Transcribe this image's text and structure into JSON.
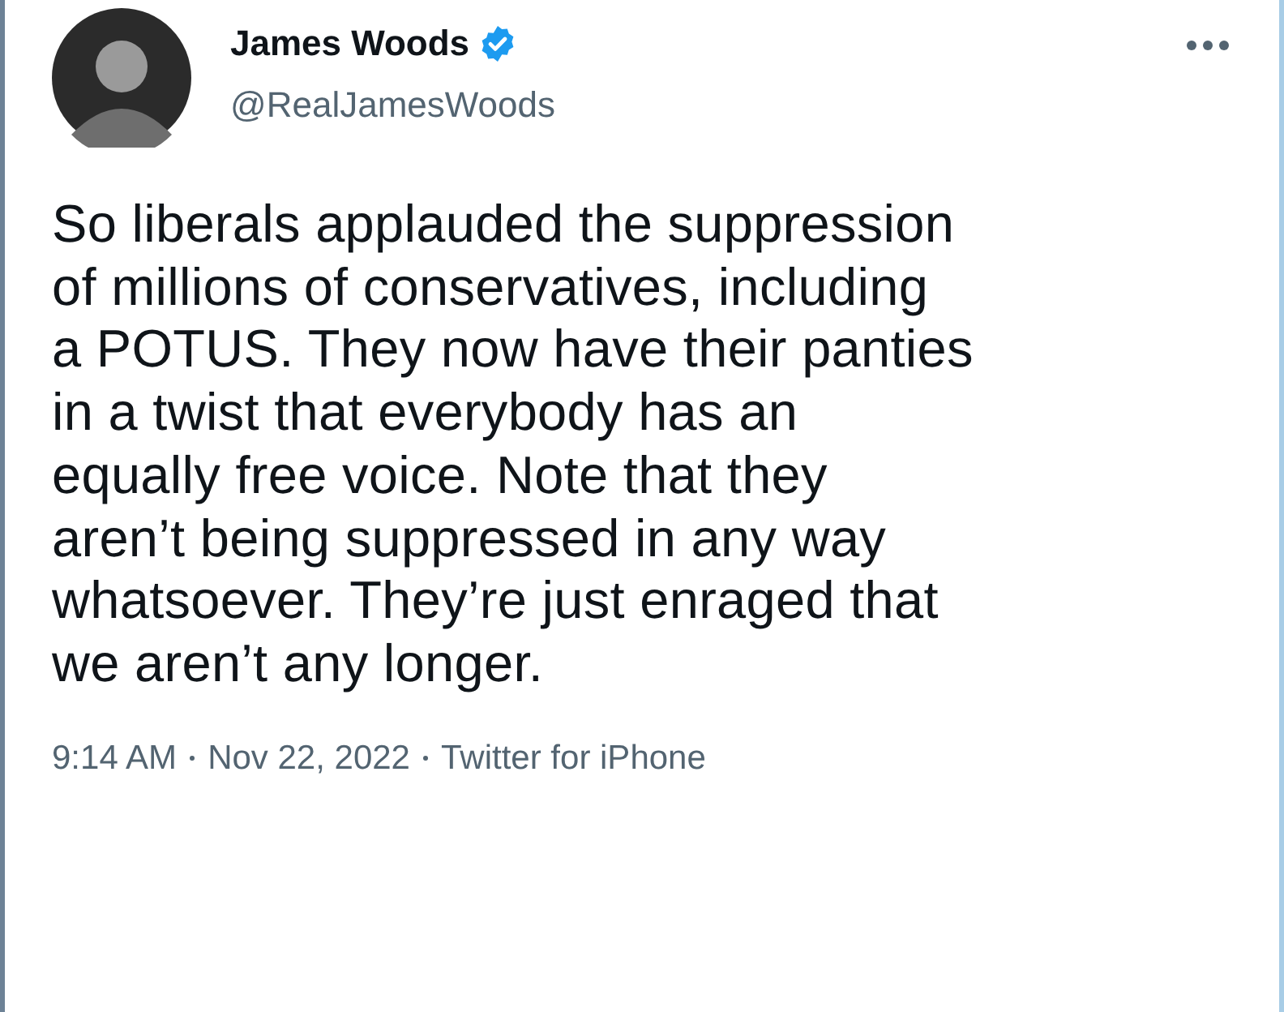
{
  "author": {
    "name": "James Woods",
    "verified": true,
    "handle": "@RealJamesWoods"
  },
  "tweet": {
    "text": "So liberals applauded the suppression\nof millions of conservatives, including\na POTUS. They now have their panties\nin a twist that everybody has an\nequally free voice. Note that they\naren’t being suppressed in any way\nwhatsoever. They’re just enraged that\nwe aren’t any longer.",
    "meta": [
      "9:14 AM",
      "Nov 22, 2022",
      "Twitter for iPhone"
    ]
  }
}
